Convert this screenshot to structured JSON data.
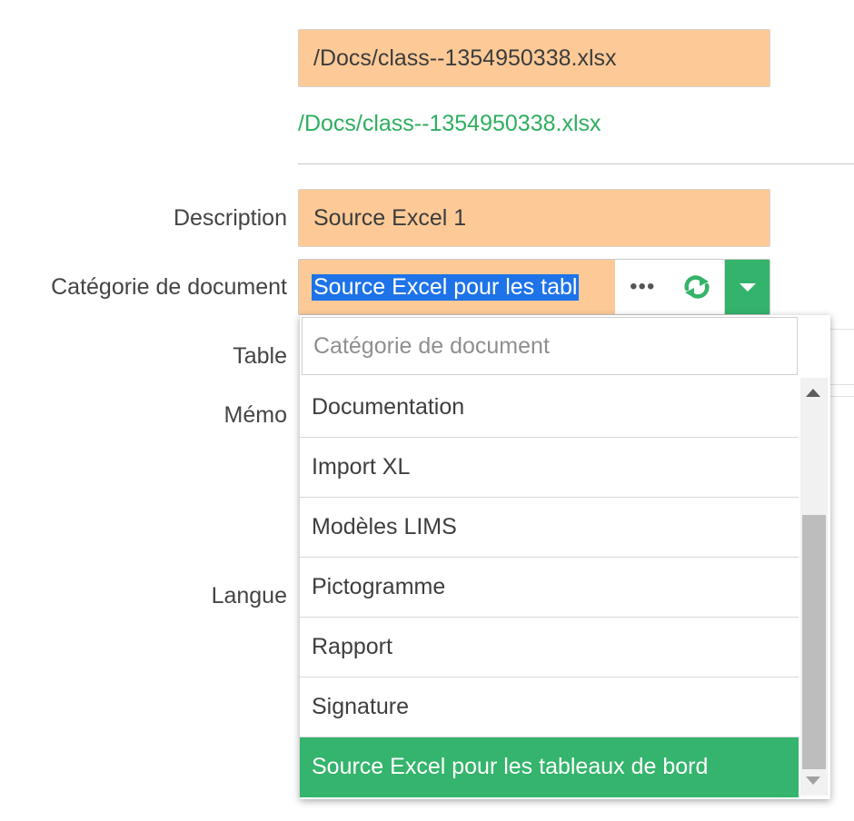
{
  "file": {
    "path_value": "/Docs/class--1354950338.xlsx",
    "path_link": "/Docs/class--1354950338.xlsx"
  },
  "form": {
    "description_label": "Description",
    "description_value": "Source Excel 1",
    "category_label": "Catégorie de document",
    "category_value": "Source Excel pour les tabl",
    "table_label": "Table",
    "memo_label": "Mémo",
    "language_label": "Langue"
  },
  "combo": {
    "more_glyph": "•••",
    "refresh_glyph": "⟳"
  },
  "dropdown": {
    "search_placeholder": "Catégorie de document",
    "items": [
      "Documentation",
      "Import XL",
      "Modèles LIMS",
      "Pictogramme",
      "Rapport",
      "Signature",
      "Source Excel pour les tableaux de bord"
    ],
    "selected_index": 6
  },
  "colors": {
    "field_bg": "#fdca97",
    "accent_green": "#34b46c",
    "selection_blue": "#1e73e8"
  }
}
